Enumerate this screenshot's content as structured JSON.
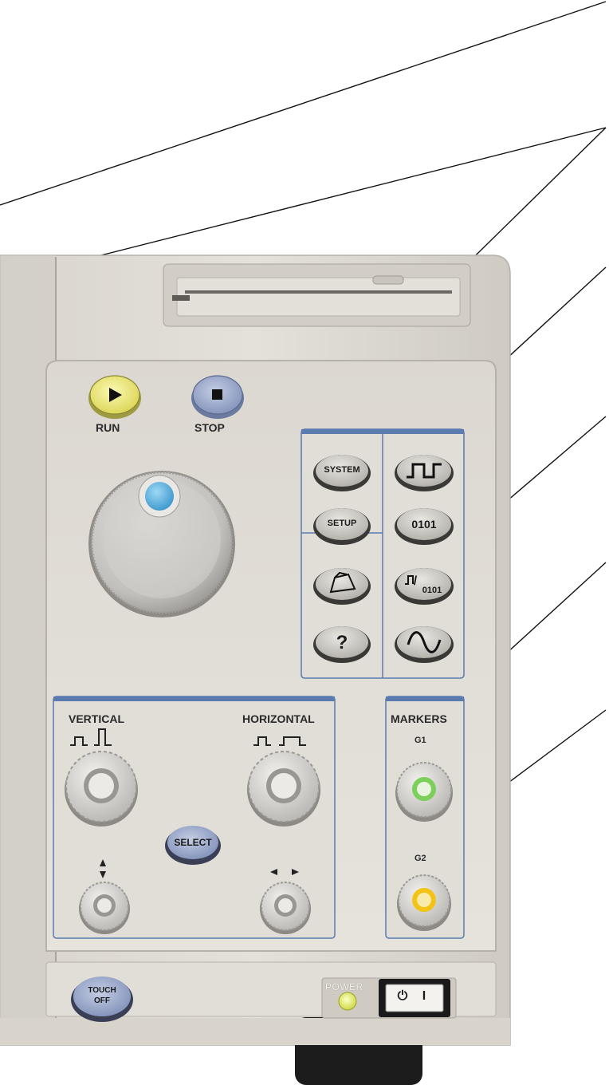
{
  "transport": {
    "run_label": "RUN",
    "stop_label": "STOP"
  },
  "menu_buttons": {
    "system_label": "SYSTEM",
    "setup_label": "SETUP",
    "pattern_label": "0101",
    "help_label": "?",
    "waveform_pattern_slash_label": "/",
    "waveform_pattern_code_label": "0101"
  },
  "vertical_horizontal": {
    "vertical_label": "VERTICAL",
    "horizontal_label": "HORIZONTAL",
    "select_label": "SELECT"
  },
  "markers": {
    "title": "MARKERS",
    "g1_label": "G1",
    "g2_label": "G2"
  },
  "bottom": {
    "touch_off_line1": "TOUCH",
    "touch_off_line2": "OFF",
    "power_label": "POWER",
    "power_switch_off": "⏻",
    "power_switch_on": "I"
  },
  "colors": {
    "run_button": "#f3ee6f",
    "stop_button": "#8e9fc6",
    "select_button": "#8e9fc6",
    "touch_off_button": "#8e9fc6",
    "panel_outline": "#5a7ab0",
    "knob_cap_blue": "#5fb8e6",
    "g1_knob_ring": "#7ccf5a",
    "g2_knob_ring": "#f2c314",
    "power_led": "#e9f05a"
  }
}
